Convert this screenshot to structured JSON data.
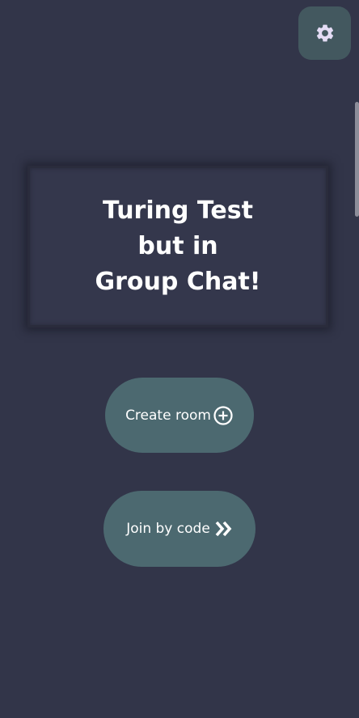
{
  "header": {
    "settings_icon": "gear-icon"
  },
  "title_card": {
    "lines": [
      "Turing Test",
      "but in",
      "Group Chat!"
    ]
  },
  "actions": {
    "create_room": {
      "label": "Create room",
      "icon": "plus-circle-icon"
    },
    "join_by_code": {
      "label": "Join by code",
      "icon": "double-chevron-right-icon"
    }
  },
  "colors": {
    "background": "#323549",
    "card": "#34374c",
    "button": "#4c6970",
    "settings_button": "#43585f",
    "gear": "#e4dcf5",
    "text": "#ffffff"
  }
}
